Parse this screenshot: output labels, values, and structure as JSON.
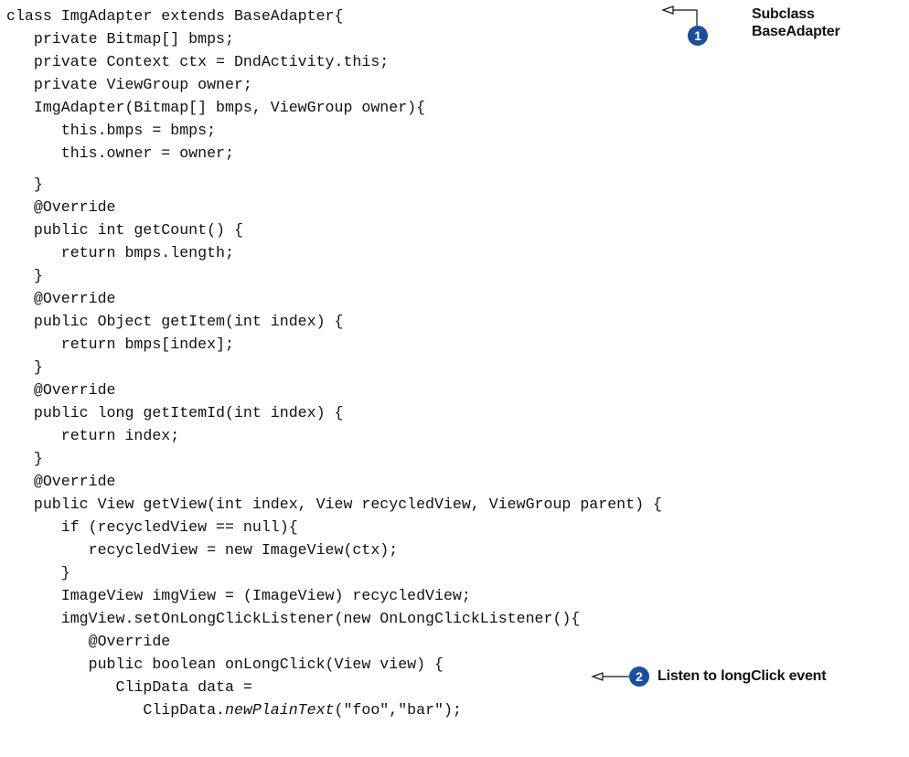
{
  "code_lines": [
    "class ImgAdapter extends BaseAdapter{",
    "   private Bitmap[] bmps;",
    "   private Context ctx = DndActivity.this;",
    "   private ViewGroup owner;",
    "   ImgAdapter(Bitmap[] bmps, ViewGroup owner){",
    "      this.bmps = bmps;",
    "      this.owner = owner;",
    "   }",
    "   @Override",
    "   public int getCount() {",
    "      return bmps.length;",
    "   }",
    "   @Override",
    "   public Object getItem(int index) {",
    "      return bmps[index];",
    "   }",
    "   @Override",
    "   public long getItemId(int index) {",
    "      return index;",
    "   }",
    "   @Override",
    "   public View getView(int index, View recycledView, ViewGroup parent) {",
    "      if (recycledView == null){",
    "         recycledView = new ImageView(ctx);",
    "      }",
    "      ImageView imgView = (ImageView) recycledView;",
    "      imgView.setOnLongClickListener(new OnLongClickListener(){",
    "         @Override",
    "         public boolean onLongClick(View view) {",
    "            ClipData data =",
    "               ClipData."
  ],
  "italic_method": "newPlainText",
  "last_line_tail": "(\"foo\",\"bar\");",
  "annotations": [
    {
      "number": "1",
      "label_line1": "Subclass",
      "label_line2": "BaseAdapter"
    },
    {
      "number": "2",
      "label": "Listen to longClick event"
    }
  ]
}
